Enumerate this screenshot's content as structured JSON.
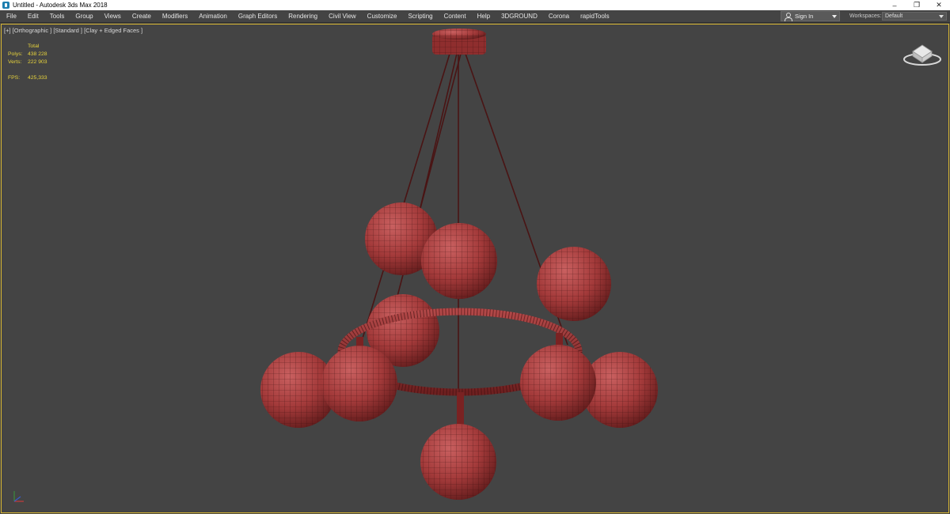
{
  "window": {
    "title": "Untitled - Autodesk 3ds Max 2018",
    "controls": {
      "minimize": "–",
      "restore": "❐",
      "close": "✕"
    }
  },
  "menu": [
    "File",
    "Edit",
    "Tools",
    "Group",
    "Views",
    "Create",
    "Modifiers",
    "Animation",
    "Graph Editors",
    "Rendering",
    "Civil View",
    "Customize",
    "Scripting",
    "Content",
    "Help",
    "3DGROUND",
    "Corona",
    "rapidTools"
  ],
  "signin": {
    "label": "Sign In"
  },
  "workspaces": {
    "label": "Workspaces:",
    "value": "Default"
  },
  "viewport": {
    "label": "[+] [Orthographic ] [Standard ] [Clay + Edged Faces ]",
    "stats": {
      "header": "Total",
      "polys_label": "Polys:",
      "polys": "438 228",
      "verts_label": "Verts:",
      "verts": "222 903",
      "fps_label": "FPS:",
      "fps": "425,333"
    }
  },
  "colors": {
    "viewport_bg": "#444444",
    "active_border": "#d9b733",
    "stats_text": "#e7d33c",
    "clay_red": "#a33a3a",
    "wire": "#4a1414"
  },
  "icons": [
    "app-icon",
    "user-icon",
    "viewcube-icon",
    "axis-gizmo-icon"
  ]
}
